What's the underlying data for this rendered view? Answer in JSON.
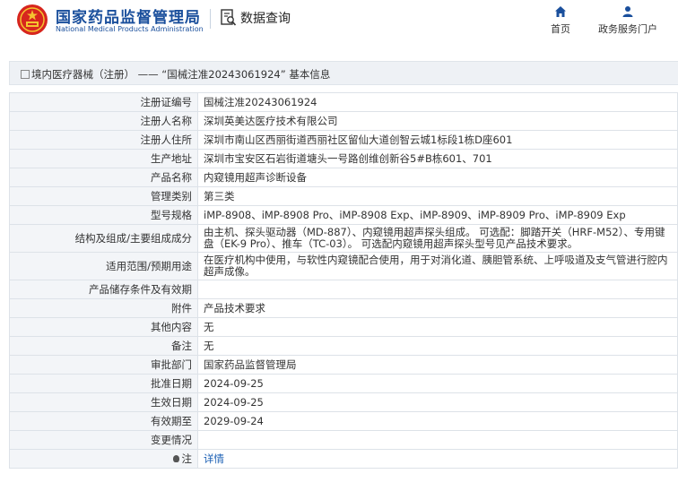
{
  "header": {
    "brand_cn": "国家药品监督管理局",
    "brand_en": "National Medical Products Administration",
    "section_title": "数据查询",
    "nav": [
      {
        "label": "首页",
        "icon": "home-icon"
      },
      {
        "label": "政务服务门户",
        "icon": "user-icon"
      }
    ]
  },
  "breadcrumb": {
    "text": "境内医疗器械（注册） —— “国械注准20243061924” 基本信息"
  },
  "details": [
    {
      "label": "注册证编号",
      "value": "国械注准20243061924"
    },
    {
      "label": "注册人名称",
      "value": "深圳英美达医疗技术有限公司"
    },
    {
      "label": "注册人住所",
      "value": "深圳市南山区西丽街道西丽社区留仙大道创智云城1标段1栋D座601"
    },
    {
      "label": "生产地址",
      "value": "深圳市宝安区石岩街道塘头一号路创维创新谷5#B栋601、701"
    },
    {
      "label": "产品名称",
      "value": "内窥镜用超声诊断设备"
    },
    {
      "label": "管理类别",
      "value": "第三类"
    },
    {
      "label": "型号规格",
      "value": "iMP-8908、iMP-8908 Pro、iMP-8908 Exp、iMP-8909、iMP-8909 Pro、iMP-8909 Exp"
    },
    {
      "label": "结构及组成/主要组成成分",
      "value": "由主机、探头驱动器（MD-887）、内窥镜用超声探头组成。 可选配：脚踏开关（HRF-M52）、专用键盘（EK-9 Pro）、推车（TC-03）。 可选配内窥镜用超声探头型号见产品技术要求。"
    },
    {
      "label": "适用范围/预期用途",
      "value": "在医疗机构中使用，与软性内窥镜配合使用，用于对消化道、胰胆管系统、上呼吸道及支气管进行腔内超声成像。"
    },
    {
      "label": "产品储存条件及有效期",
      "value": ""
    },
    {
      "label": "附件",
      "value": "产品技术要求"
    },
    {
      "label": "其他内容",
      "value": "无"
    },
    {
      "label": "备注",
      "value": "无"
    },
    {
      "label": "审批部门",
      "value": "国家药品监督管理局"
    },
    {
      "label": "批准日期",
      "value": "2024-09-25"
    },
    {
      "label": "生效日期",
      "value": "2024-09-25"
    },
    {
      "label": "有效期至",
      "value": "2029-09-24"
    },
    {
      "label": "变更情况",
      "value": ""
    }
  ],
  "note": {
    "label": "注",
    "link": "详情"
  },
  "colors": {
    "brand": "#1a4f9c",
    "link": "#1a5fb4",
    "label_bg": "#f3f5f8"
  }
}
